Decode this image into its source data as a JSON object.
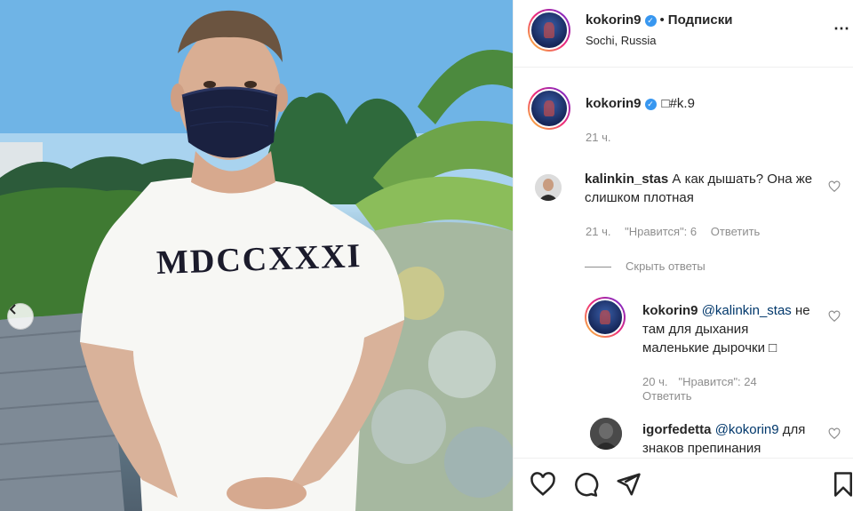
{
  "header": {
    "username": "kokorin9",
    "separator": "•",
    "follow_label": "Подписки",
    "location": "Sochi, Russia",
    "more": "⋯"
  },
  "photo": {
    "shirt_text": "MDCCXXXI"
  },
  "caption": {
    "username": "kokorin9",
    "text": "□#k.9",
    "time": "21 ч."
  },
  "comments": [
    {
      "username": "kalinkin_stas",
      "text": "А как дышать? Она же слишком плотная",
      "time": "21 ч.",
      "likes": "\"Нравится\": 6",
      "reply": "Ответить"
    }
  ],
  "hide_replies": "Скрыть ответы",
  "replies": [
    {
      "username": "kokorin9",
      "mention": "@kalinkin_stas",
      "text": "не там для дыхания маленькие дырочки □",
      "time": "20 ч.",
      "likes": "\"Нравится\": 24",
      "reply": "Ответить"
    },
    {
      "username": "igorfedetta",
      "mention": "@kokorin9",
      "text": "для знаков препинания"
    }
  ],
  "icons": [
    "heart-icon",
    "comment-icon",
    "share-icon",
    "bookmark-icon",
    "verified-icon",
    "chevron-left-icon"
  ],
  "colors": {
    "link": "#00376b",
    "verified": "#3897f0",
    "meta": "#8e8e8e"
  }
}
